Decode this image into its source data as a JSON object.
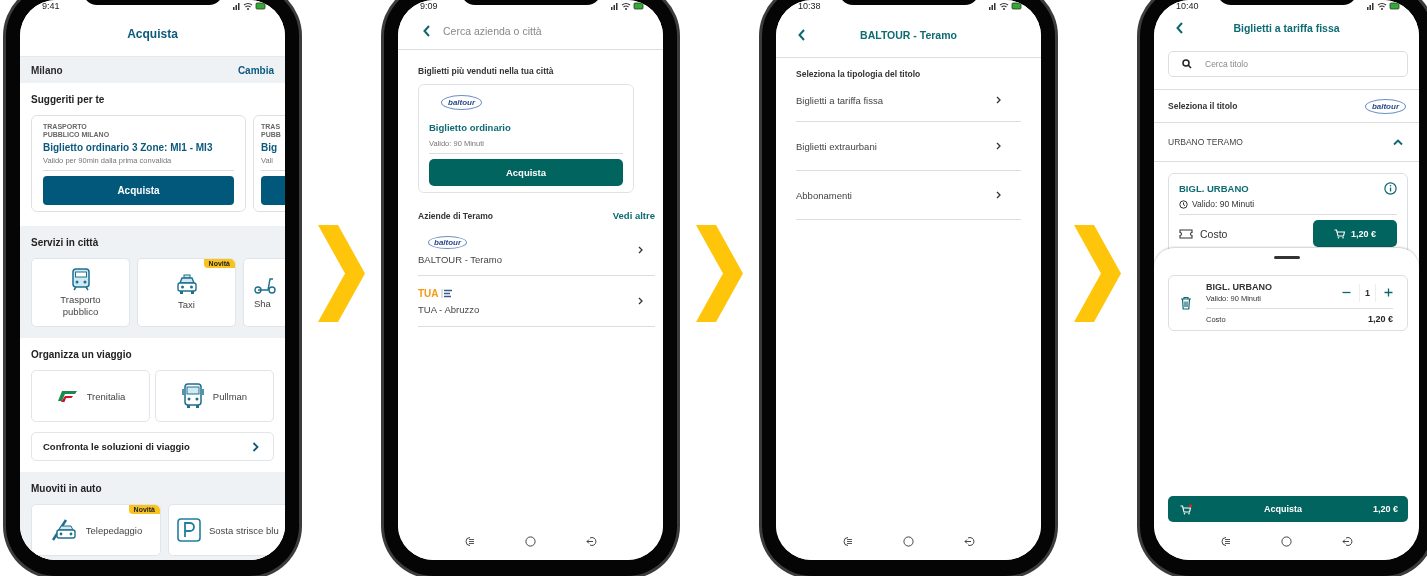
{
  "screens": [
    {
      "kind": "home",
      "status_time": "9:41",
      "title": "Acquista",
      "city": {
        "name": "Milano",
        "action": "Cambia"
      },
      "suggested": {
        "heading": "Suggeriti per te",
        "cards": [
          {
            "operator": "TRASPORTO PUBBLICO MILANO",
            "title": "Biglietto ordinario 3 Zone: MI1 - MI3",
            "subtitle": "Valido per 90min dalla prima convalida",
            "button": "Acquista"
          },
          {
            "operator": "TRAS PUBB",
            "title": "Big",
            "subtitle": "Vali"
          }
        ]
      },
      "services": {
        "heading": "Servizi in città",
        "tiles": [
          {
            "kind": "train",
            "label": "Trasporto pubblico"
          },
          {
            "kind": "taxi",
            "label": "Taxi",
            "badge": "Novità"
          },
          {
            "kind": "scooter",
            "label": "Sha"
          }
        ]
      },
      "trip": {
        "heading": "Organizza un viaggio",
        "tiles": [
          {
            "kind": "trenitalia",
            "label": "Trenitalia"
          },
          {
            "kind": "bus",
            "label": "Pullman"
          }
        ],
        "compare": "Confronta le soluzioni di viaggio"
      },
      "auto": {
        "heading": "Muoviti in auto",
        "tiles": [
          {
            "kind": "toll",
            "label": "Telepedaggio",
            "badge": "Novità"
          },
          {
            "kind": "parking",
            "label": "Sosta strisce blu"
          }
        ]
      }
    },
    {
      "kind": "search",
      "status_time": "9:09",
      "search": {
        "placeholder": "Cerca azienda o città"
      },
      "bestsellers": {
        "heading": "Biglietti più venduti nella tua città",
        "card": {
          "logo": "baltour",
          "title": "Biglietto ordinario",
          "validity": "Valido: 90 Minuti",
          "button": "Acquista"
        }
      },
      "companies": {
        "heading": "Aziende di Teramo",
        "action": "Vedi altre",
        "items": [
          {
            "kind": "baltour",
            "logo": "baltour",
            "name": "BALTOUR - Teramo"
          },
          {
            "kind": "tua",
            "logo": "TUA",
            "name": "TUA - Abruzzo"
          }
        ]
      }
    },
    {
      "kind": "company",
      "status_time": "10:38",
      "title": "BALTOUR - Teramo",
      "heading": "Seleziona la tipologia del titolo",
      "items": [
        "Biglietti a tariffa fissa",
        "Biglietti extraurbani",
        "Abbonamenti"
      ]
    },
    {
      "kind": "tickets",
      "status_time": "10:40",
      "title": "Biglietti a tariffa fissa",
      "search": {
        "placeholder": "Cerca titolo"
      },
      "select_label": "Seleziona il titolo",
      "logo": "baltour",
      "group": {
        "label": "URBANO TERAMO",
        "expanded": true
      },
      "ticket": {
        "name": "BIGL. URBANO",
        "validity": "Valido: 90 Minuti",
        "cost_label": "Costo",
        "price": "1,20 €"
      },
      "cart": {
        "items": [
          {
            "name": "BIGL. URBANO",
            "validity": "Valido: 90 Minuti",
            "quantity": "1",
            "cost_label": "Costo",
            "price": "1,20 €"
          }
        ]
      },
      "checkout": {
        "label": "Acquista",
        "total": "1,20 €"
      }
    }
  ]
}
